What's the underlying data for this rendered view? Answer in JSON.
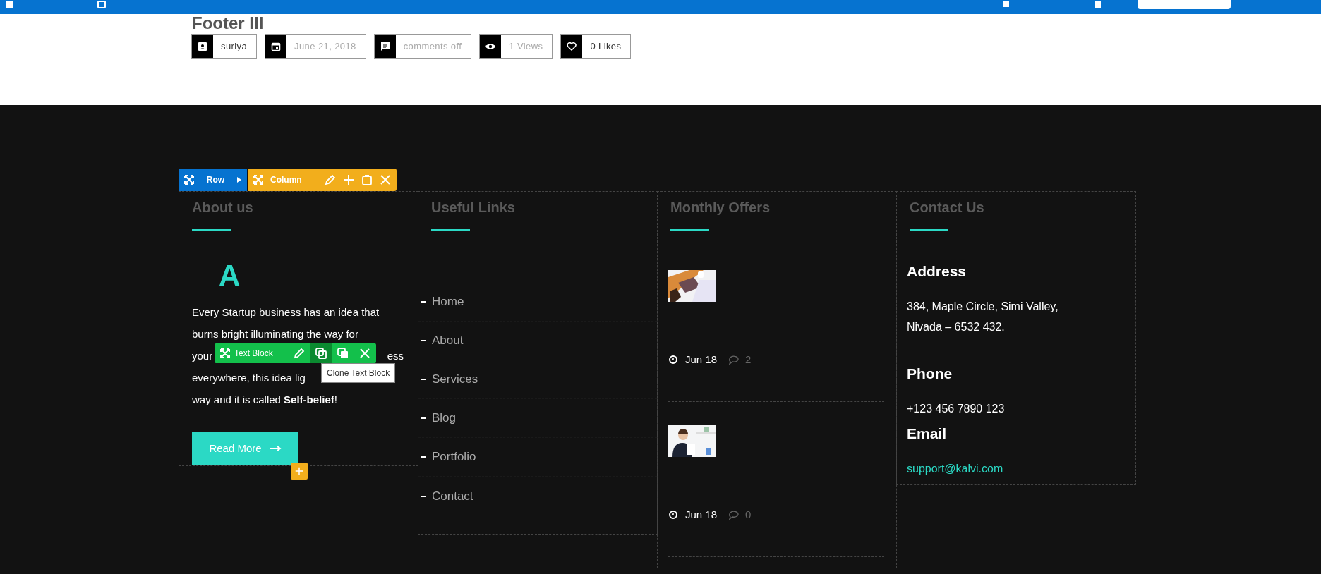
{
  "post": {
    "title": "Footer III",
    "meta": [
      {
        "kind": "author",
        "text": "suriya",
        "muted": false
      },
      {
        "kind": "date",
        "text": "June 21, 2018",
        "muted": true
      },
      {
        "kind": "comments",
        "text": "comments off",
        "muted": true
      },
      {
        "kind": "views",
        "text": "1 Views",
        "muted": true
      },
      {
        "kind": "likes",
        "text": "0 Likes",
        "muted": false
      }
    ]
  },
  "builder": {
    "row_label": "Row",
    "column_label": "Column",
    "text_block_label": "Text Block",
    "tooltip": "Clone Text Block"
  },
  "footer": {
    "about": {
      "heading": "About us",
      "logo_letter": "A",
      "lines": [
        {
          "text": "Every Startup business has an idea that"
        },
        {
          "text": "burns bright illuminating the way for"
        },
        {
          "text": "your",
          "tail": "ess"
        },
        {
          "text": "everywhere, this idea lig"
        },
        {
          "text": "way and it is called **Self-belief**!"
        }
      ],
      "button": "Read More"
    },
    "links": {
      "heading": "Useful Links",
      "items": [
        "Home",
        "About",
        "Services",
        "Blog",
        "Portfolio",
        "Contact"
      ]
    },
    "offers": {
      "heading": "Monthly Offers",
      "posts": [
        {
          "date": "Jun 18",
          "comments": "2"
        },
        {
          "date": "Jun 18",
          "comments": "0"
        }
      ]
    },
    "contact": {
      "heading": "Contact Us",
      "sections": [
        {
          "label": "Address",
          "kind": "text",
          "lines": [
            "384, Maple Circle, Simi Valley,",
            "Nivada – 6532 432."
          ]
        },
        {
          "label": "Phone",
          "kind": "text",
          "lines": [
            "+123 456 7890 123"
          ]
        },
        {
          "label": "Email",
          "kind": "link",
          "lines": [
            "support@kalvi.com"
          ]
        }
      ]
    }
  }
}
